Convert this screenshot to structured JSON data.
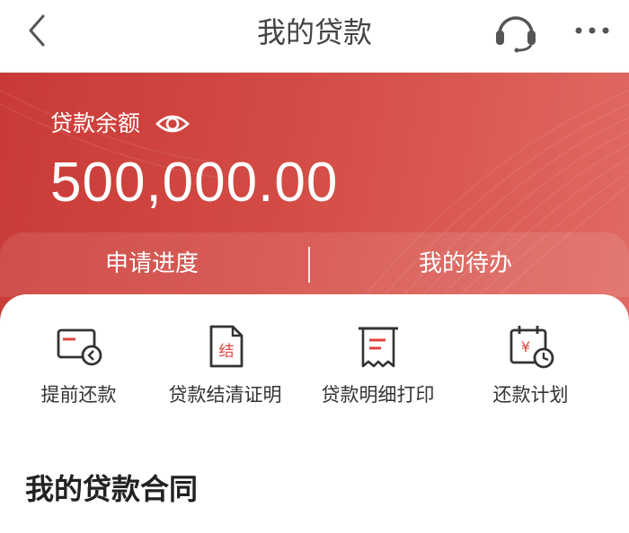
{
  "header": {
    "title": "我的贷款"
  },
  "hero": {
    "balance_label": "贷款余额",
    "balance_amount": "500,000.00",
    "tabs": [
      {
        "label": "申请进度"
      },
      {
        "label": "我的待办"
      }
    ],
    "colors": {
      "background": "#d44b45",
      "text": "#ffffff"
    }
  },
  "actions": [
    {
      "label": "提前还款",
      "icon": "early-repay-icon"
    },
    {
      "label": "贷款结清证明",
      "icon": "settlement-certificate-icon",
      "glyph": "结"
    },
    {
      "label": "贷款明细打印",
      "icon": "receipt-print-icon"
    },
    {
      "label": "还款计划",
      "icon": "repayment-calendar-icon",
      "glyph": "¥"
    }
  ],
  "section": {
    "title": "我的贷款合同"
  }
}
